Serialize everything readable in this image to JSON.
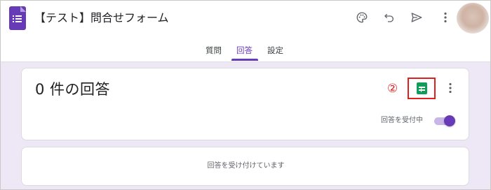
{
  "header": {
    "title": "【テスト】問合せフォーム",
    "icons": [
      "palette-icon",
      "undo-icon",
      "send-icon",
      "more-vert-icon"
    ]
  },
  "tabs": [
    {
      "label": "質問",
      "active": false
    },
    {
      "label": "回答",
      "active": true
    },
    {
      "label": "設定",
      "active": false
    }
  ],
  "responses": {
    "title": "0 件の回答",
    "annotation": "②",
    "sheets_icon": "sheets-icon",
    "accepting_label": "回答を受付中",
    "accepting": true,
    "message": "回答を受け付けています"
  },
  "colors": {
    "accent": "#673ab7",
    "background": "#ede7f6",
    "sheets_green": "#0f9d58",
    "annotation_red": "#e0201c"
  }
}
